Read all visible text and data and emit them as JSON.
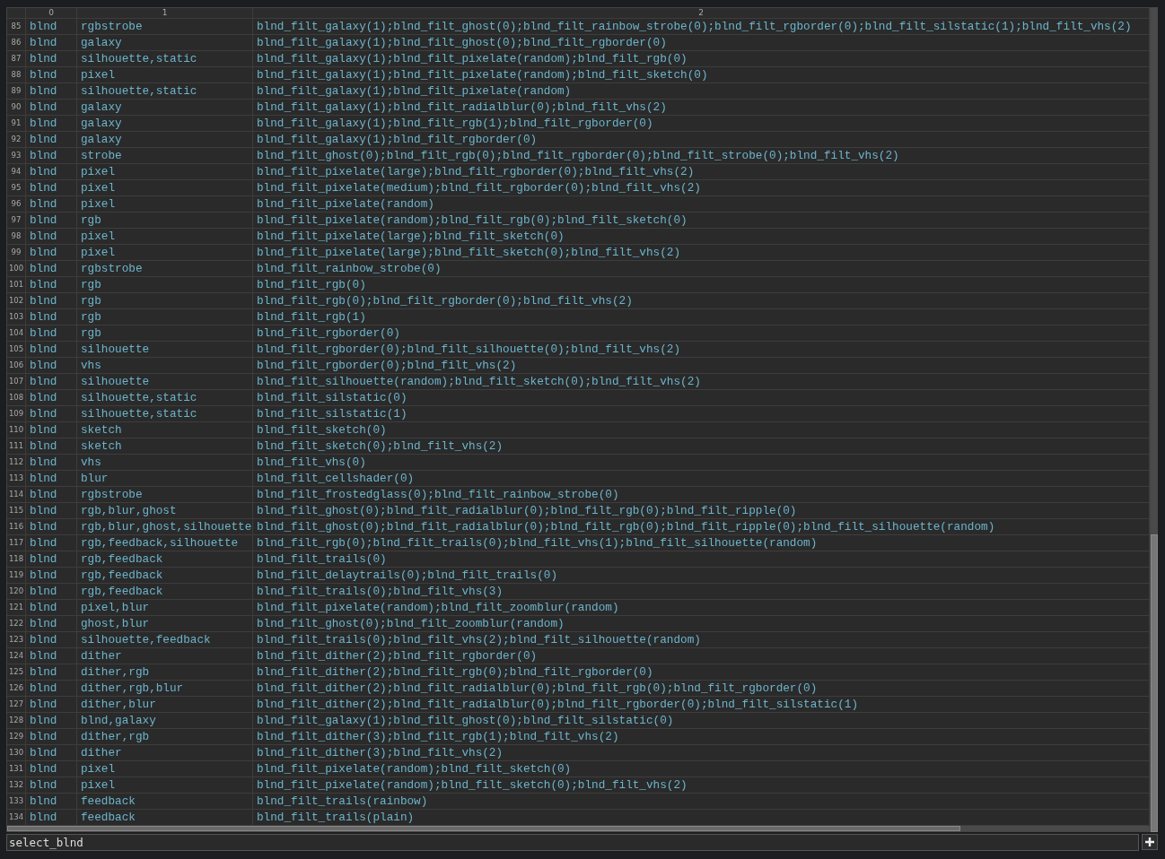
{
  "table": {
    "columns": [
      "0",
      "1",
      "2"
    ],
    "rows": [
      {
        "index": "85",
        "cells": [
          "blnd",
          "rgbstrobe",
          "blnd_filt_galaxy(1);blnd_filt_ghost(0);blnd_filt_rainbow_strobe(0);blnd_filt_rgborder(0);blnd_filt_silstatic(1);blnd_filt_vhs(2)"
        ]
      },
      {
        "index": "86",
        "cells": [
          "blnd",
          "galaxy",
          "blnd_filt_galaxy(1);blnd_filt_ghost(0);blnd_filt_rgborder(0)"
        ]
      },
      {
        "index": "87",
        "cells": [
          "blnd",
          "silhouette,static",
          "blnd_filt_galaxy(1);blnd_filt_pixelate(random);blnd_filt_rgb(0)"
        ]
      },
      {
        "index": "88",
        "cells": [
          "blnd",
          "pixel",
          "blnd_filt_galaxy(1);blnd_filt_pixelate(random);blnd_filt_sketch(0)"
        ]
      },
      {
        "index": "89",
        "cells": [
          "blnd",
          "silhouette,static",
          "blnd_filt_galaxy(1);blnd_filt_pixelate(random)"
        ]
      },
      {
        "index": "90",
        "cells": [
          "blnd",
          "galaxy",
          "blnd_filt_galaxy(1);blnd_filt_radialblur(0);blnd_filt_vhs(2)"
        ]
      },
      {
        "index": "91",
        "cells": [
          "blnd",
          "galaxy",
          "blnd_filt_galaxy(1);blnd_filt_rgb(1);blnd_filt_rgborder(0)"
        ]
      },
      {
        "index": "92",
        "cells": [
          "blnd",
          "galaxy",
          "blnd_filt_galaxy(1);blnd_filt_rgborder(0)"
        ]
      },
      {
        "index": "93",
        "cells": [
          "blnd",
          "strobe",
          "blnd_filt_ghost(0);blnd_filt_rgb(0);blnd_filt_rgborder(0);blnd_filt_strobe(0);blnd_filt_vhs(2)"
        ]
      },
      {
        "index": "94",
        "cells": [
          "blnd",
          "pixel",
          "blnd_filt_pixelate(large);blnd_filt_rgborder(0);blnd_filt_vhs(2)"
        ]
      },
      {
        "index": "95",
        "cells": [
          "blnd",
          "pixel",
          "blnd_filt_pixelate(medium);blnd_filt_rgborder(0);blnd_filt_vhs(2)"
        ]
      },
      {
        "index": "96",
        "cells": [
          "blnd",
          "pixel",
          "blnd_filt_pixelate(random)"
        ]
      },
      {
        "index": "97",
        "cells": [
          "blnd",
          "rgb",
          "blnd_filt_pixelate(random);blnd_filt_rgb(0);blnd_filt_sketch(0)"
        ]
      },
      {
        "index": "98",
        "cells": [
          "blnd",
          "pixel",
          "blnd_filt_pixelate(large);blnd_filt_sketch(0)"
        ]
      },
      {
        "index": "99",
        "cells": [
          "blnd",
          "pixel",
          "blnd_filt_pixelate(large);blnd_filt_sketch(0);blnd_filt_vhs(2)"
        ]
      },
      {
        "index": "100",
        "cells": [
          "blnd",
          "rgbstrobe",
          "blnd_filt_rainbow_strobe(0)"
        ]
      },
      {
        "index": "101",
        "cells": [
          "blnd",
          "rgb",
          "blnd_filt_rgb(0)"
        ]
      },
      {
        "index": "102",
        "cells": [
          "blnd",
          "rgb",
          "blnd_filt_rgb(0);blnd_filt_rgborder(0);blnd_filt_vhs(2)"
        ]
      },
      {
        "index": "103",
        "cells": [
          "blnd",
          "rgb",
          "blnd_filt_rgb(1)"
        ]
      },
      {
        "index": "104",
        "cells": [
          "blnd",
          "rgb",
          "blnd_filt_rgborder(0)"
        ]
      },
      {
        "index": "105",
        "cells": [
          "blnd",
          "silhouette",
          "blnd_filt_rgborder(0);blnd_filt_silhouette(0);blnd_filt_vhs(2)"
        ]
      },
      {
        "index": "106",
        "cells": [
          "blnd",
          "vhs",
          "blnd_filt_rgborder(0);blnd_filt_vhs(2)"
        ]
      },
      {
        "index": "107",
        "cells": [
          "blnd",
          "silhouette",
          "blnd_filt_silhouette(random);blnd_filt_sketch(0);blnd_filt_vhs(2)"
        ]
      },
      {
        "index": "108",
        "cells": [
          "blnd",
          "silhouette,static",
          "blnd_filt_silstatic(0)"
        ]
      },
      {
        "index": "109",
        "cells": [
          "blnd",
          "silhouette,static",
          "blnd_filt_silstatic(1)"
        ]
      },
      {
        "index": "110",
        "cells": [
          "blnd",
          "sketch",
          "blnd_filt_sketch(0)"
        ]
      },
      {
        "index": "111",
        "cells": [
          "blnd",
          "sketch",
          "blnd_filt_sketch(0);blnd_filt_vhs(2)"
        ]
      },
      {
        "index": "112",
        "cells": [
          "blnd",
          "vhs",
          "blnd_filt_vhs(0)"
        ]
      },
      {
        "index": "113",
        "cells": [
          "blnd",
          "blur",
          "blnd_filt_cellshader(0)"
        ]
      },
      {
        "index": "114",
        "cells": [
          "blnd",
          "rgbstrobe",
          "blnd_filt_frostedglass(0);blnd_filt_rainbow_strobe(0)"
        ]
      },
      {
        "index": "115",
        "cells": [
          "blnd",
          "rgb,blur,ghost",
          "blnd_filt_ghost(0);blnd_filt_radialblur(0);blnd_filt_rgb(0);blnd_filt_ripple(0)"
        ]
      },
      {
        "index": "116",
        "cells": [
          "blnd",
          "rgb,blur,ghost,silhouette",
          "blnd_filt_ghost(0);blnd_filt_radialblur(0);blnd_filt_rgb(0);blnd_filt_ripple(0);blnd_filt_silhouette(random)"
        ]
      },
      {
        "index": "117",
        "cells": [
          "blnd",
          "rgb,feedback,silhouette",
          "blnd_filt_rgb(0);blnd_filt_trails(0);blnd_filt_vhs(1);blnd_filt_silhouette(random)"
        ]
      },
      {
        "index": "118",
        "cells": [
          "blnd",
          "rgb,feedback",
          "blnd_filt_trails(0)"
        ]
      },
      {
        "index": "119",
        "cells": [
          "blnd",
          "rgb,feedback",
          "blnd_filt_delaytrails(0);blnd_filt_trails(0)"
        ]
      },
      {
        "index": "120",
        "cells": [
          "blnd",
          "rgb,feedback",
          "blnd_filt_trails(0);blnd_filt_vhs(3)"
        ]
      },
      {
        "index": "121",
        "cells": [
          "blnd",
          "pixel,blur",
          "blnd_filt_pixelate(random);blnd_filt_zoomblur(random)"
        ]
      },
      {
        "index": "122",
        "cells": [
          "blnd",
          "ghost,blur",
          "blnd_filt_ghost(0);blnd_filt_zoomblur(random)"
        ]
      },
      {
        "index": "123",
        "cells": [
          "blnd",
          "silhouette,feedback",
          "blnd_filt_trails(0);blnd_filt_vhs(2);blnd_filt_silhouette(random)"
        ]
      },
      {
        "index": "124",
        "cells": [
          "blnd",
          "dither",
          "blnd_filt_dither(2);blnd_filt_rgborder(0)"
        ]
      },
      {
        "index": "125",
        "cells": [
          "blnd",
          "dither,rgb",
          "blnd_filt_dither(2);blnd_filt_rgb(0);blnd_filt_rgborder(0)"
        ]
      },
      {
        "index": "126",
        "cells": [
          "blnd",
          "dither,rgb,blur",
          "blnd_filt_dither(2);blnd_filt_radialblur(0);blnd_filt_rgb(0);blnd_filt_rgborder(0)"
        ]
      },
      {
        "index": "127",
        "cells": [
          "blnd",
          "dither,blur",
          "blnd_filt_dither(2);blnd_filt_radialblur(0);blnd_filt_rgborder(0);blnd_filt_silstatic(1)"
        ]
      },
      {
        "index": "128",
        "cells": [
          "blnd",
          "blnd,galaxy",
          "blnd_filt_galaxy(1);blnd_filt_ghost(0);blnd_filt_silstatic(0)"
        ]
      },
      {
        "index": "129",
        "cells": [
          "blnd",
          "dither,rgb",
          "blnd_filt_dither(3);blnd_filt_rgb(1);blnd_filt_vhs(2)"
        ]
      },
      {
        "index": "130",
        "cells": [
          "blnd",
          "dither",
          "blnd_filt_dither(3);blnd_filt_vhs(2)"
        ]
      },
      {
        "index": "131",
        "cells": [
          "blnd",
          "pixel",
          "blnd_filt_pixelate(random);blnd_filt_sketch(0)"
        ]
      },
      {
        "index": "132",
        "cells": [
          "blnd",
          "pixel",
          "blnd_filt_pixelate(random);blnd_filt_sketch(0);blnd_filt_vhs(2)"
        ]
      },
      {
        "index": "133",
        "cells": [
          "blnd",
          "feedback",
          "blnd_filt_trails(rainbow)"
        ]
      },
      {
        "index": "134",
        "cells": [
          "blnd",
          "feedback",
          "blnd_filt_trails(plain)"
        ]
      }
    ]
  },
  "field": {
    "value": "select_blnd"
  }
}
